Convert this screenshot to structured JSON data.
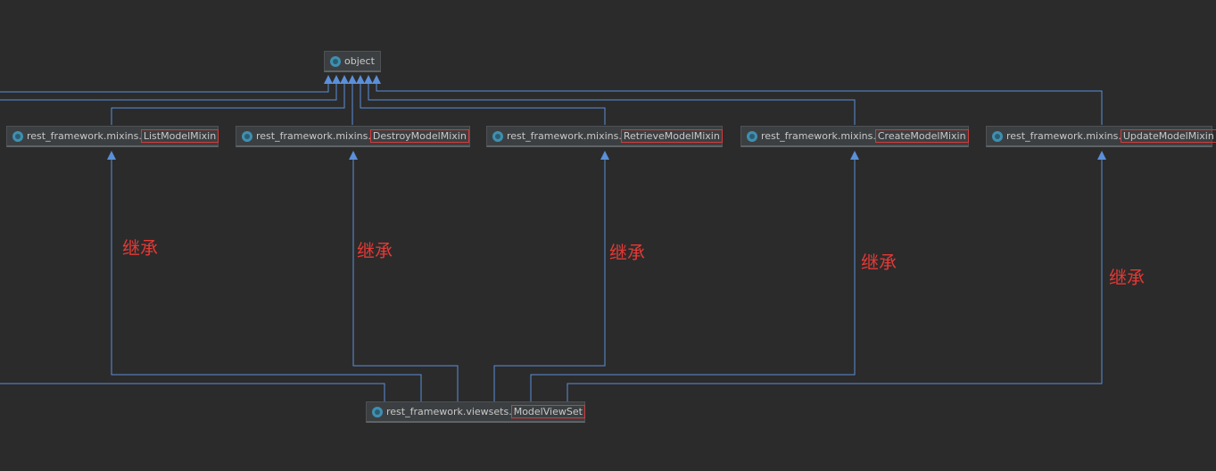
{
  "diagram": {
    "root": {
      "label": "object"
    },
    "mixins": [
      {
        "prefix": "rest_framework.mixins.",
        "name": "ListModelMixin"
      },
      {
        "prefix": "rest_framework.mixins.",
        "name": "DestroyModelMixin"
      },
      {
        "prefix": "rest_framework.mixins.",
        "name": "RetrieveModelMixin"
      },
      {
        "prefix": "rest_framework.mixins.",
        "name": "CreateModelMixin"
      },
      {
        "prefix": "rest_framework.mixins.",
        "name": "UpdateModelMixin"
      }
    ],
    "child": {
      "prefix": "rest_framework.viewsets.",
      "name": "ModelViewSet"
    },
    "annotation": "继承",
    "colors": {
      "edge": "#5b8fd8",
      "highlight": "#d33b3b",
      "annotation": "#e53935"
    }
  }
}
